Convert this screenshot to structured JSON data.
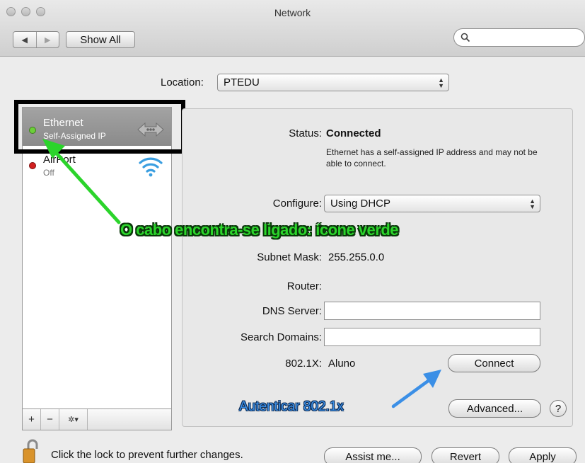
{
  "window": {
    "title": "Network"
  },
  "toolbar": {
    "back_glyph": "◀",
    "forward_glyph": "▶",
    "show_all_label": "Show All",
    "search_value": "",
    "search_icon": "search-icon"
  },
  "location": {
    "label": "Location:",
    "value": "PTEDU"
  },
  "services": [
    {
      "name": "Ethernet",
      "status": "Self-Assigned IP",
      "dot_color": "#6ccf3a",
      "icon": "ethernet-arrows-icon",
      "selected": true
    },
    {
      "name": "AirPort",
      "status": "Off",
      "dot_color": "#d22020",
      "icon": "wifi-icon",
      "selected": false
    }
  ],
  "sidebar_buttons": {
    "add": "+",
    "remove": "−",
    "action": "✲▾"
  },
  "detail": {
    "status_label": "Status:",
    "status_value": "Connected",
    "status_desc": "Ethernet has a self-assigned IP address and may not be able to connect.",
    "configure_label": "Configure:",
    "configure_value": "Using DHCP",
    "subnet_label": "Subnet Mask:",
    "subnet_value": "255.255.0.0",
    "router_label": "Router:",
    "router_value": "",
    "dns_label": "DNS Server:",
    "dns_value": "",
    "search_domains_label": "Search Domains:",
    "search_domains_value": "",
    "dot1x_label": "802.1X:",
    "dot1x_value": "Aluno",
    "connect_label": "Connect",
    "advanced_label": "Advanced...",
    "help_label": "?"
  },
  "annotations": {
    "green_text": "O cabo encontra-se ligado: ícone verde",
    "green_color": "#2bd42b",
    "blue_text": "Autenticar 802.1x",
    "blue_color": "#3b8fe6"
  },
  "footer": {
    "lock_text": "Click the lock to prevent further changes.",
    "assist_label": "Assist me...",
    "revert_label": "Revert",
    "apply_label": "Apply"
  }
}
